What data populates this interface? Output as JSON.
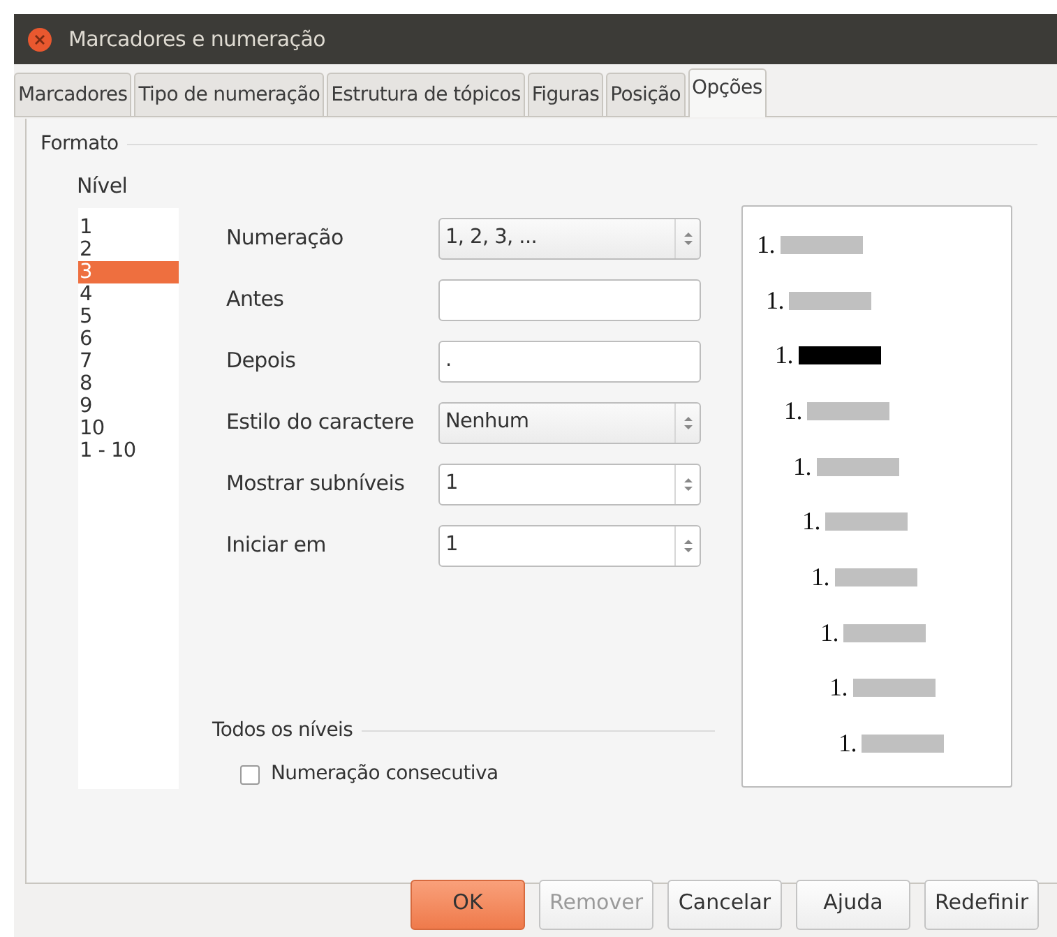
{
  "window": {
    "title": "Marcadores e numeração"
  },
  "tabs": [
    {
      "label": "Marcadores",
      "selected": false
    },
    {
      "label": "Tipo de numeração",
      "selected": false
    },
    {
      "label": "Estrutura de tópicos",
      "selected": false
    },
    {
      "label": "Figuras",
      "selected": false
    },
    {
      "label": "Posição",
      "selected": false
    },
    {
      "label": "Opções",
      "selected": true
    }
  ],
  "format": {
    "title": "Formato",
    "level_label": "Nível",
    "levels": [
      {
        "label": "1",
        "selected": false
      },
      {
        "label": "2",
        "selected": false
      },
      {
        "label": "3",
        "selected": true
      },
      {
        "label": "4",
        "selected": false
      },
      {
        "label": "5",
        "selected": false
      },
      {
        "label": "6",
        "selected": false
      },
      {
        "label": "7",
        "selected": false
      },
      {
        "label": "8",
        "selected": false
      },
      {
        "label": "9",
        "selected": false
      },
      {
        "label": "10",
        "selected": false
      },
      {
        "label": "1 - 10",
        "selected": false
      }
    ],
    "fields": [
      {
        "label": "Numeração",
        "kind": "select",
        "value": "1, 2, 3, ..."
      },
      {
        "label": "Antes",
        "kind": "text"
      },
      {
        "label": "Depois",
        "kind": "text",
        "value": "."
      },
      {
        "label": "Estilo do caractere",
        "kind": "select",
        "value": "Nenhum"
      },
      {
        "label": "Mostrar subníveis",
        "kind": "spin",
        "value": "1"
      },
      {
        "label": "Iniciar em",
        "kind": "spin",
        "value": "1"
      }
    ],
    "preview": [
      {
        "label": "1.",
        "selected": false
      },
      {
        "label": "1.",
        "selected": false
      },
      {
        "label": "1.",
        "selected": true
      },
      {
        "label": "1.",
        "selected": false
      },
      {
        "label": "1.",
        "selected": false
      },
      {
        "label": "1.",
        "selected": false
      },
      {
        "label": "1.",
        "selected": false
      },
      {
        "label": "1.",
        "selected": false
      },
      {
        "label": "1.",
        "selected": false
      },
      {
        "label": "1.",
        "selected": false
      }
    ]
  },
  "all_levels": {
    "title": "Todos os níveis",
    "checkbox": {
      "label": "Numeração consecutiva",
      "checked": false
    }
  },
  "buttons": [
    {
      "label": "OK",
      "kind": "default",
      "disabled": false
    },
    {
      "label": "Remover",
      "kind": "normal",
      "disabled": true
    },
    {
      "label": "Cancelar",
      "kind": "normal",
      "disabled": false
    },
    {
      "label": "Ajuda",
      "kind": "normal",
      "disabled": false
    },
    {
      "label": "Redefinir",
      "kind": "normal",
      "disabled": false
    }
  ]
}
